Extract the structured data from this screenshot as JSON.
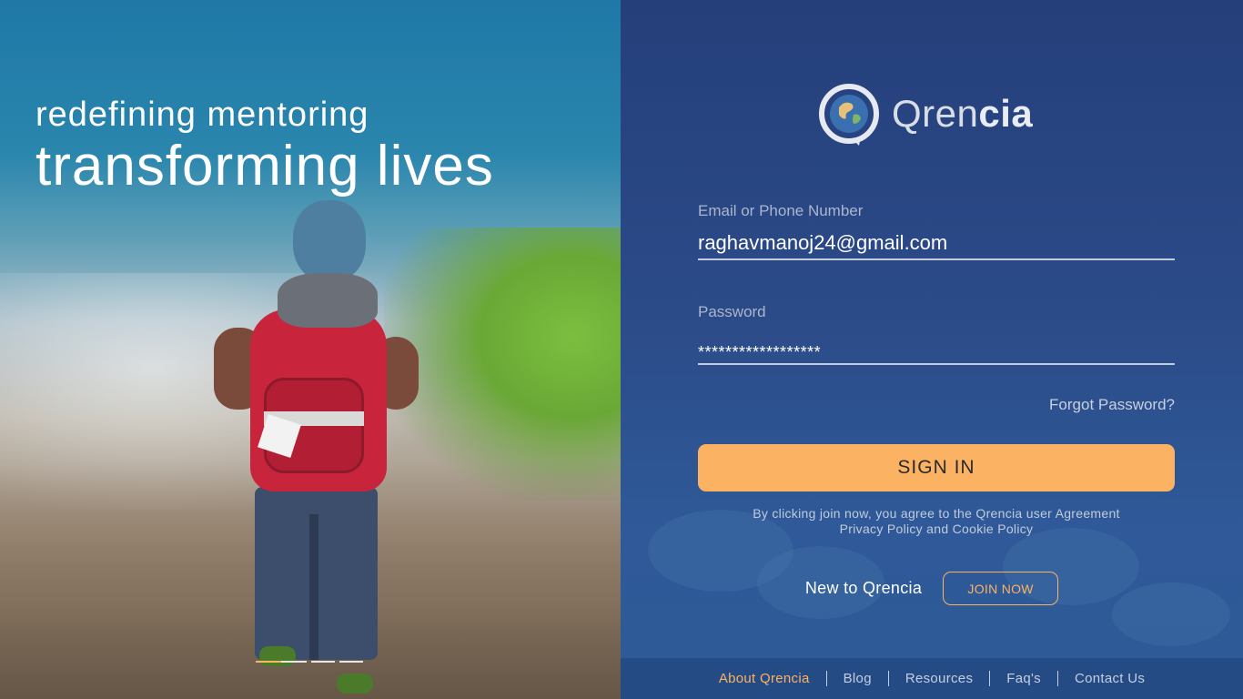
{
  "hero": {
    "line1": "redefining mentoring",
    "line2": "transforming lives",
    "carousel": {
      "count": 4,
      "active_index": 0
    }
  },
  "brand": {
    "name_light": "Qren",
    "name_bold": "cia",
    "logo_icon": "globe-chat-icon"
  },
  "form": {
    "email": {
      "label": "Email or Phone Number",
      "value": "raghavmanoj24@gmail.com"
    },
    "password": {
      "label": "Password",
      "value": "******************"
    },
    "forgot_label": "Forgot Password?",
    "signin_label": "SIGN IN",
    "agreement_line1": "By clicking join now, you agree to the Qrencia user Agreement",
    "agreement_line2": "Privacy Policy and Cookie Policy"
  },
  "join": {
    "prompt": "New to Qrencia",
    "button_label": "JOIN NOW"
  },
  "footer": {
    "links": [
      "About Qrencia",
      "Blog",
      "Resources",
      "Faq's",
      "Contact Us"
    ],
    "active_index": 0
  },
  "colors": {
    "accent": "#fbb363",
    "panel_bg": "#2b4b88",
    "hero_sky": "#1f78a6"
  }
}
